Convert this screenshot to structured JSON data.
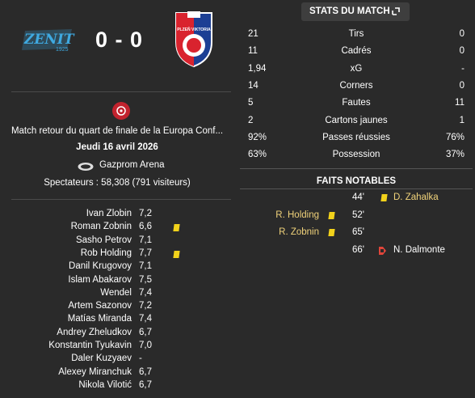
{
  "match": {
    "home_logo_text": "ZENIT",
    "home_logo_year": "1925",
    "away_logo_text": "PLZEŇ VIKTORIA",
    "score": "0 - 0",
    "competition": "Match retour du quart de finale de la Europa Conf...",
    "date": "Jeudi 16 avril 2026",
    "stadium": "Gazprom Arena",
    "attendance": "Spectateurs : 58,308 (791 visiteurs)"
  },
  "players": [
    {
      "name": "Ivan Zlobin",
      "rating": "7,2",
      "card": false
    },
    {
      "name": "Roman Zobnin",
      "rating": "6,6",
      "card": true
    },
    {
      "name": "Sasho Petrov",
      "rating": "7,1",
      "card": false
    },
    {
      "name": "Rob Holding",
      "rating": "7,7",
      "card": true
    },
    {
      "name": "Danil Krugovoy",
      "rating": "7,1",
      "card": false
    },
    {
      "name": "Islam Abakarov",
      "rating": "7,5",
      "card": false
    },
    {
      "name": "Wendel",
      "rating": "7,4",
      "card": false
    },
    {
      "name": "Artem Sazonov",
      "rating": "7,2",
      "card": false
    },
    {
      "name": "Matías Miranda",
      "rating": "7,4",
      "card": false
    },
    {
      "name": "Andrey Zheludkov",
      "rating": "6,7",
      "card": false
    },
    {
      "name": "Konstantin Tyukavin",
      "rating": "7,0",
      "card": false
    },
    {
      "name": "Daler Kuzyaev",
      "rating": "-",
      "card": false
    },
    {
      "name": "Alexey Miranchuk",
      "rating": "6,7",
      "card": false
    },
    {
      "name": "Nikola Vilotić",
      "rating": "6,7",
      "card": false
    }
  ],
  "stats": {
    "tab_label": "STATS DU MATCH",
    "rows": [
      {
        "home": "21",
        "label": "Tirs",
        "away": "0"
      },
      {
        "home": "11",
        "label": "Cadrés",
        "away": "0"
      },
      {
        "home": "1,94",
        "label": "xG",
        "away": "-"
      },
      {
        "home": "14",
        "label": "Corners",
        "away": "0"
      },
      {
        "home": "5",
        "label": "Fautes",
        "away": "11"
      },
      {
        "home": "2",
        "label": "Cartons jaunes",
        "away": "1"
      },
      {
        "home": "92%",
        "label": "Passes réussies",
        "away": "76%"
      },
      {
        "home": "63%",
        "label": "Possession",
        "away": "37%"
      }
    ]
  },
  "highlights": {
    "title": "FAITS NOTABLES",
    "events": [
      {
        "minute": "44'",
        "home_player": "",
        "away_player": "D. Zahalka",
        "type": "yellow-card",
        "side": "away"
      },
      {
        "minute": "52'",
        "home_player": "R. Holding",
        "away_player": "",
        "type": "yellow-card",
        "side": "home"
      },
      {
        "minute": "65'",
        "home_player": "R. Zobnin",
        "away_player": "",
        "type": "yellow-card",
        "side": "home"
      },
      {
        "minute": "66'",
        "home_player": "",
        "away_player": "N. Dalmonte",
        "type": "injury",
        "side": "away"
      }
    ]
  },
  "colors": {
    "background": "#2a2a2a",
    "zenit_blue": "#3fa9e0",
    "viktoria_red": "#d9232e",
    "viktoria_blue": "#1c3f94",
    "yellow_card": "#f2d21b",
    "highlight_name": "#f0d27a"
  }
}
